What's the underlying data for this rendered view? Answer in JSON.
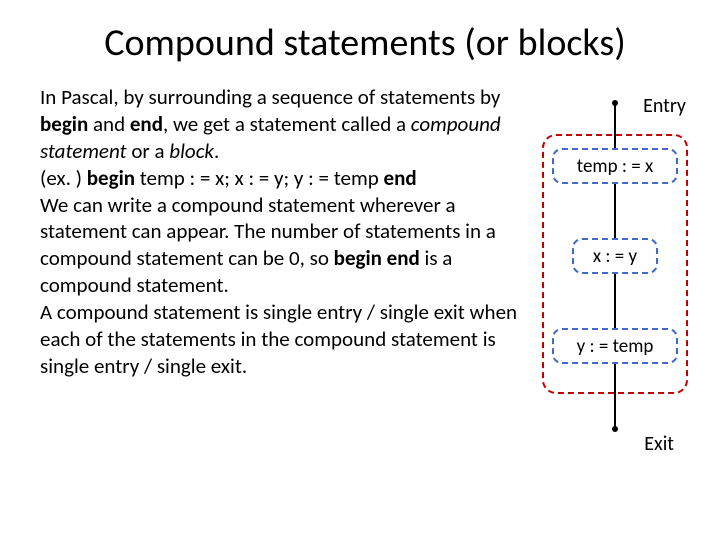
{
  "title": "Compound statements (or blocks)",
  "para": {
    "p1a": "In Pascal, by surrounding a sequence of statements by ",
    "begin1": "begin",
    "p1b": " and ",
    "end1": "end",
    "p1c": ", we get a statement called a ",
    "it1": "compound statement",
    "p1d": " or a ",
    "it2": "block",
    "p1e": ".",
    "ex_a": "(ex. ) ",
    "begin2": "begin",
    "ex_b": " temp : = x;  x : = y;  y : = temp ",
    "end2": "end",
    "p2": "We can write a compound statement wherever a statement can appear. The number of statements in a compound statement can be 0, so ",
    "begin3": "begin end",
    "p2b": " is a compound statement.",
    "p3": "A compound statement is single entry / single exit when each of the statements in the compound statement is single entry / single exit."
  },
  "diagram": {
    "entry": "Entry",
    "exit": "Exit",
    "n1": "temp : = x",
    "n2": "x : = y",
    "n3": "y : = temp"
  }
}
